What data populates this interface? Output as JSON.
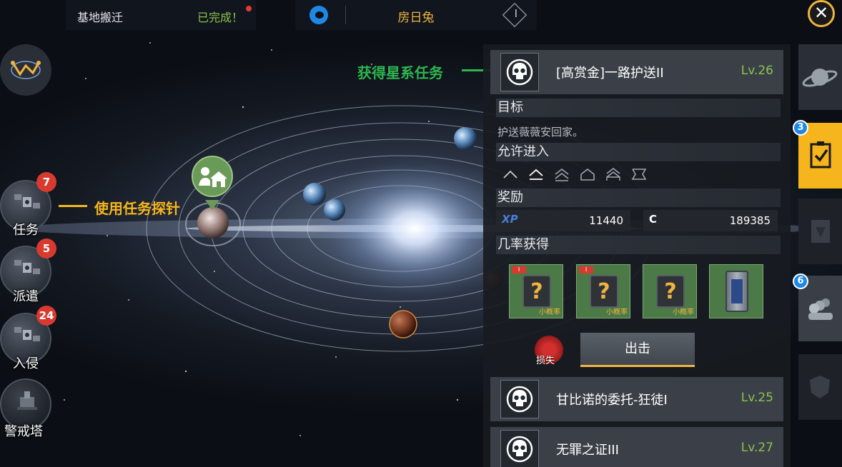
{
  "top_bar": {
    "relocate_label": "基地搬迁",
    "relocate_status": "已完成！",
    "player_name": "房日兔",
    "rank_numeral": "I"
  },
  "close_icon": "close-icon",
  "side_menu": [
    {
      "label": "任务",
      "badge": "7",
      "icon": "probe-satellite-icon"
    },
    {
      "label": "派遣",
      "badge": "5",
      "icon": "probe-satellite-icon"
    },
    {
      "label": "入侵",
      "badge": "24",
      "icon": "probe-satellite-icon"
    },
    {
      "label": "警戒塔",
      "badge": "",
      "icon": "turret-icon"
    }
  ],
  "annotations": {
    "get_mission": "获得星系任务",
    "use_probe": "使用任务探针"
  },
  "colors": {
    "accent_gold": "#f6b51c",
    "level_green": "#8bc34a",
    "annotation_green": "#2fb550",
    "annotation_gold": "#f6b51c",
    "badge_red": "#d83a2f",
    "badge_blue": "#1e88e5"
  },
  "quest_detail": {
    "title": "[高赏金]一路护送II",
    "level": "Lv.26",
    "objective_heading": "目标",
    "objective_text": "护送薇薇安回家。",
    "access_heading": "允许进入",
    "rewards_heading": "奖励",
    "reward_xp_label": "XP",
    "reward_xp": "11440",
    "reward_credit_label": "C",
    "reward_credit": "189385",
    "drops_heading": "几率获得",
    "drops": [
      {
        "label": "小概率",
        "icon": "mystery-crate-icon",
        "tagged": true
      },
      {
        "label": "小概率",
        "icon": "mystery-crate-icon",
        "tagged": true
      },
      {
        "label": "小概率",
        "icon": "mystery-crate-icon",
        "tagged": false
      },
      {
        "label": "",
        "icon": "blueprint-pack-icon",
        "tagged": false
      }
    ],
    "loss_label": "损失",
    "attack_button": "出击"
  },
  "quest_list": [
    {
      "title": "甘比诺的委托-狂徒I",
      "level": "Lv.25"
    },
    {
      "title": "无罪之证III",
      "level": "Lv.27"
    }
  ],
  "right_tabs": [
    {
      "icon": "planet-icon",
      "badge": "",
      "active": false
    },
    {
      "icon": "mission-checklist-icon",
      "badge": "3",
      "active": true
    },
    {
      "icon": "intel-icon",
      "badge": "",
      "active": false
    },
    {
      "icon": "fleet-group-icon",
      "badge": "6",
      "active": false
    },
    {
      "icon": "shield-emblem-icon",
      "badge": "",
      "active": false
    }
  ]
}
